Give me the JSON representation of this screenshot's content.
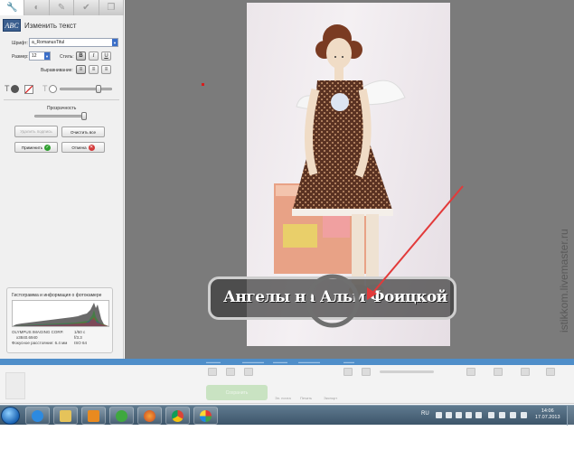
{
  "left_panel": {
    "tabs": [
      {
        "name": "wrench-icon",
        "glyph": "🔧",
        "active": true
      },
      {
        "name": "circle-half-icon",
        "glyph": "◐",
        "active": false
      },
      {
        "name": "brush-icon",
        "glyph": "✎",
        "active": false
      },
      {
        "name": "check-icon",
        "glyph": "✔",
        "active": false
      },
      {
        "name": "stack-icon",
        "glyph": "❐",
        "active": false
      }
    ],
    "header_icon": "ABC",
    "title": "Изменить текст",
    "font_label": "Шрифт:",
    "font_value": "a_RomanusTitul",
    "size_label": "Размер:",
    "size_value": "12",
    "style_label": "Стиль:",
    "style_buttons": [
      "B",
      "I",
      "U"
    ],
    "align_label": "Выравнивание:",
    "opacity_label": "Прозрачность",
    "remove_label": "Удалить подпись",
    "clear_label": "Очистить все",
    "apply_label": "Применить",
    "cancel_label": "Отмена",
    "histogram_title": "Гистограмма и информация о фотокамере",
    "camera": "OLYMPUS IMAGING CORP.",
    "resolution": "x3840.6940",
    "shutter": "1/50 с",
    "aperture": "f/3.3",
    "focal_label": "Фокусное расстояние: 6.4 мм",
    "iso": "ISO 64"
  },
  "canvas": {
    "caption": "Ангелы на Альм Фоицкой"
  },
  "bottom_panel": {
    "save_label": "Сохранить",
    "actions": [
      "Эл. почта",
      "Печать",
      "Экспорт"
    ]
  },
  "taskbar": {
    "apps": [
      "windows-explorer",
      "internet-explorer",
      "file-explorer",
      "media-player",
      "mail",
      "firefox",
      "chrome",
      "picasa"
    ],
    "lang": "RU",
    "time": "14:06",
    "date": "17.07.2013"
  },
  "watermark": "istikkom.livemaster.ru",
  "colors": {
    "canvas_bg": "#7b7b7b",
    "status_strip": "#4f8ec9",
    "accent_red": "#e23a3a"
  }
}
